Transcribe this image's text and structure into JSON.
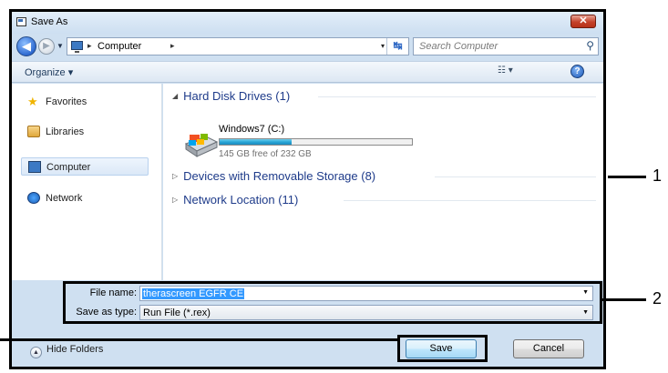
{
  "window": {
    "title": "Save As",
    "close_label": "✕"
  },
  "nav": {
    "back_glyph": "◀",
    "forward_glyph": "▶",
    "recent_glyph": "▼",
    "address": {
      "crumb": "Computer",
      "sep_glyph": "▸",
      "dropdown_glyph": "▾",
      "refresh_glyph": "↹"
    },
    "search_placeholder": "Search Computer",
    "search_glyph": "⚲"
  },
  "toolbar": {
    "organize_label": "Organize ▾",
    "views_label": "☷ ▾",
    "help_label": "?"
  },
  "sidebar": {
    "items": [
      {
        "label": "Favorites",
        "icon": "star-icon"
      },
      {
        "label": "Libraries",
        "icon": "library-icon"
      },
      {
        "label": "Computer",
        "icon": "computer-icon",
        "selected": true
      },
      {
        "label": "Network",
        "icon": "network-icon"
      }
    ]
  },
  "content": {
    "groups": [
      {
        "label": "Hard Disk Drives (1)",
        "expanded": true,
        "tri": "◢"
      },
      {
        "label": "Devices with Removable Storage (8)",
        "expanded": false,
        "tri": "▷"
      },
      {
        "label": "Network Location (11)",
        "expanded": false,
        "tri": "▷"
      }
    ],
    "drive": {
      "name": "Windows7 (C:)",
      "free_text": "145 GB free of 232 GB",
      "used_fraction": 0.375
    }
  },
  "form": {
    "filename_label": "File name:",
    "filename_value": "therascreen EGFR CE",
    "filetype_label": "Save as type:",
    "filetype_value": "Run File (*.rex)",
    "dropdown_glyph": "▼"
  },
  "footer": {
    "hide_folders_label": "Hide Folders",
    "hide_folders_glyph": "▲",
    "save_label": "Save",
    "cancel_label": "Cancel"
  },
  "callouts": [
    "1",
    "2"
  ]
}
